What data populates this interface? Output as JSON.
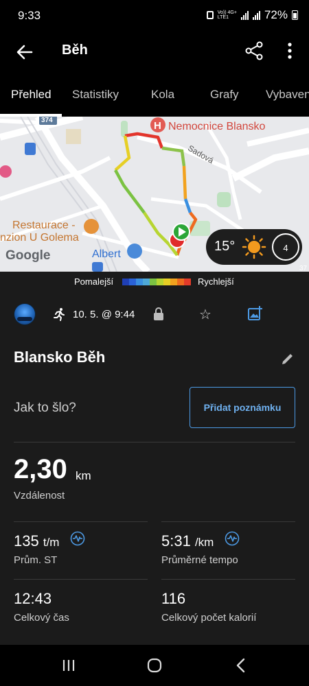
{
  "status_bar": {
    "time": "9:33",
    "network_line1": "Vo)) 4G+",
    "network_line2": "LTE1",
    "battery": "72%"
  },
  "header": {
    "title": "Běh"
  },
  "tabs": [
    {
      "label": "Přehled",
      "active": true
    },
    {
      "label": "Statistiky",
      "active": false
    },
    {
      "label": "Kola",
      "active": false
    },
    {
      "label": "Grafy",
      "active": false
    },
    {
      "label": "Vybaven",
      "active": false
    }
  ],
  "map": {
    "labels": {
      "hospital": "Nemocnice Blansko",
      "street": "Sadová",
      "road_number": "374",
      "restaurant": "Restaurace -",
      "restaurant2": "nzion U Golema",
      "shop": "Albert",
      "google": "Google",
      "road_number_small": "37"
    },
    "weather": {
      "temperature": "15°",
      "wind_speed": "4"
    }
  },
  "pace_legend": {
    "slower": "Pomalejší",
    "faster": "Rychlejší",
    "colors": [
      "#1f3fb5",
      "#2a62d8",
      "#3a8fe0",
      "#4ea8d8",
      "#7bc242",
      "#b7d531",
      "#e6cf25",
      "#f2a21e",
      "#ee6b1f",
      "#e33b2a"
    ]
  },
  "activity": {
    "date": "10. 5. @ 9:44",
    "title": "Blansko Běh",
    "prompt": "Jak to šlo?",
    "add_note": "Přidat poznámku"
  },
  "distance": {
    "value": "2,30",
    "unit": "km",
    "label": "Vzdálenost"
  },
  "stats": [
    {
      "value": "135",
      "unit": "t/m",
      "label": "Prům. ST",
      "has_info": true
    },
    {
      "value": "5:31",
      "unit": "/km",
      "label": "Průměrné tempo",
      "has_info": true
    },
    {
      "value": "12:43",
      "unit": "",
      "label": "Celkový čas",
      "has_info": false
    },
    {
      "value": "116",
      "unit": "",
      "label": "Celkový počet kalorií",
      "has_info": false
    }
  ],
  "colors": {
    "accent": "#4d9be6",
    "background": "#1b1b1b"
  }
}
